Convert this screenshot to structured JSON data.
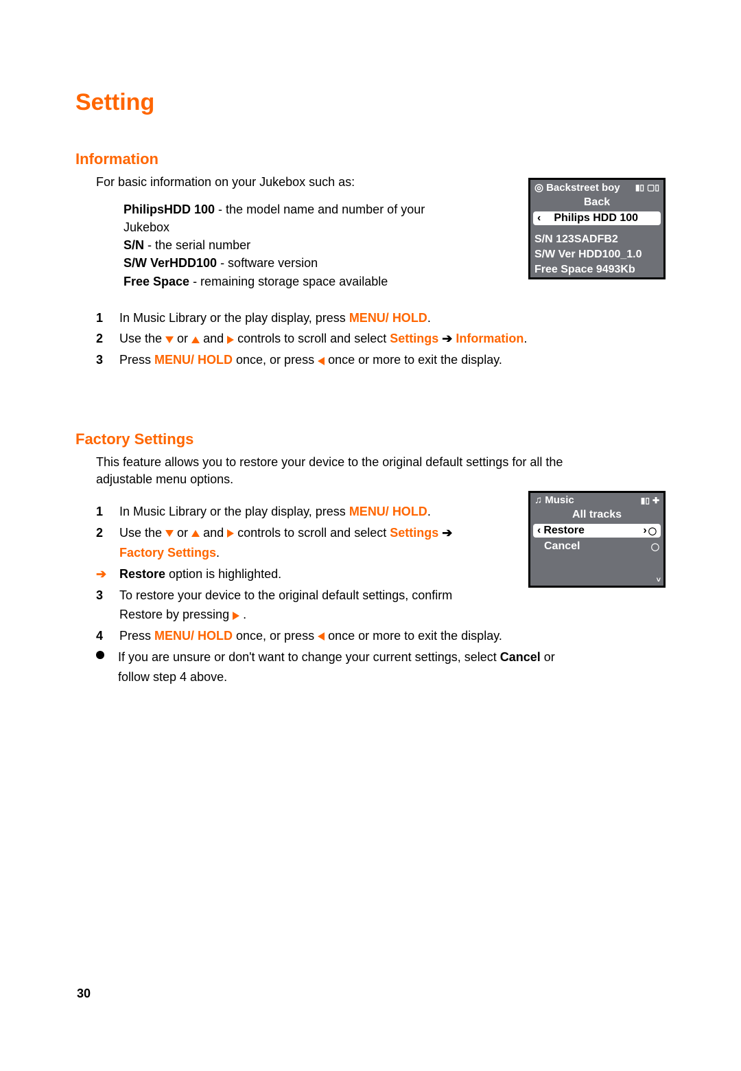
{
  "page": {
    "title": "Setting",
    "number": "30"
  },
  "information": {
    "heading": "Information",
    "intro": "For basic information on your Jukebox such as:",
    "items": {
      "model_label": "PhilipsHDD 100",
      "model_desc": " - the model name and number of your Jukebox",
      "sn_label": "S/N",
      "sn_desc": " - the serial number",
      "sw_label": "S/W VerHDD100",
      "sw_desc": "  - software version",
      "free_label": "Free Space",
      "free_desc": " - remaining storage space available"
    },
    "steps": {
      "s1a": "In Music Library or the play display, press ",
      "s1b": "MENU/ HOLD",
      "s1c": ".",
      "s2a": "Use the ",
      "s2b": " or ",
      "s2c": " and ",
      "s2d": " controls to scroll and select ",
      "s2e": "Settings",
      "s2f": "Information",
      "s2g": ".",
      "s3a": "Press ",
      "s3b": "MENU/ HOLD",
      "s3c": " once, or press ",
      "s3d": " once or more to exit the display."
    },
    "screen": {
      "status_left": "Backstreet boy",
      "row_back": "Back",
      "selected": "Philips HDD 100",
      "sn": "S/N 123SADFB2",
      "sw": "S/W Ver HDD100_1.0",
      "free": "Free Space 9493Kb"
    }
  },
  "factory": {
    "heading": "Factory Settings",
    "intro": "This feature allows you to restore your device to the original default settings for all the adjustable menu options.",
    "steps": {
      "s1a": "In Music Library or the play display, press ",
      "s1b": "MENU/ HOLD",
      "s1c": ".",
      "s2a": "Use the ",
      "s2b": " or ",
      "s2c": " and ",
      "s2d": " controls to scroll and select ",
      "s2e": "Settings",
      "s2f": "Factory Settings",
      "s2g": ".",
      "arrow_label": "Restore",
      "arrow_text": " option is highlighted.",
      "s3": "To restore your device to the original default settings, confirm Restore by pressing ",
      "s3b": " .",
      "s4a": "Press ",
      "s4b": "MENU/ HOLD",
      "s4c": " once, or press ",
      "s4d": " once or more to exit the display.",
      "bullet_a": "If you are unsure or don't want to change your current settings, select ",
      "bullet_b": "Cancel",
      "bullet_c": " or follow step 4 above."
    },
    "screen": {
      "status_left": "Music",
      "row_all": "All tracks",
      "selected": "Restore",
      "row_cancel": "Cancel"
    }
  }
}
